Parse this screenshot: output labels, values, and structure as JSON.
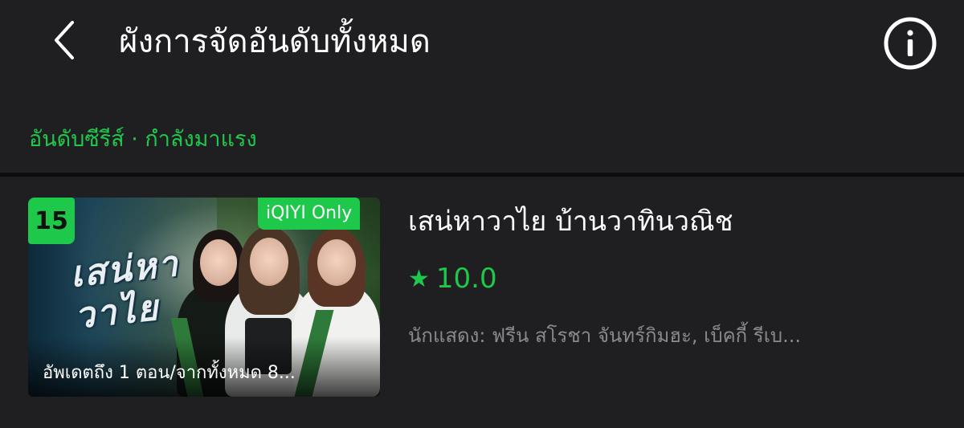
{
  "header": {
    "title": "ผังการจัดอันดับทั้งหมด",
    "back_icon": "chevron-left-icon",
    "info_icon": "info-circle-icon"
  },
  "section": {
    "label": "อันดับซีรีส์ · กำลังมาแรง"
  },
  "items": [
    {
      "rank_badge": "15",
      "exclusive_badge": "iQIYI Only",
      "poster_title": "เสน่หา วาไย",
      "episode_info": "อัพเดตถึง 1 ตอน/จากทั้งหมด 8...",
      "title": "เสน่หาวาไย บ้านวาทินวณิช",
      "rating": "10.0",
      "cast": "นักแสดง: ฟรีน สโรชา จันทร์กิมฮะ, เบ็คกี้ รีเบ..."
    }
  ],
  "colors": {
    "background": "#1f1f22",
    "accent": "#1ec84a",
    "divider": "#0c0c0d",
    "muted_text": "#8a8a8e"
  }
}
